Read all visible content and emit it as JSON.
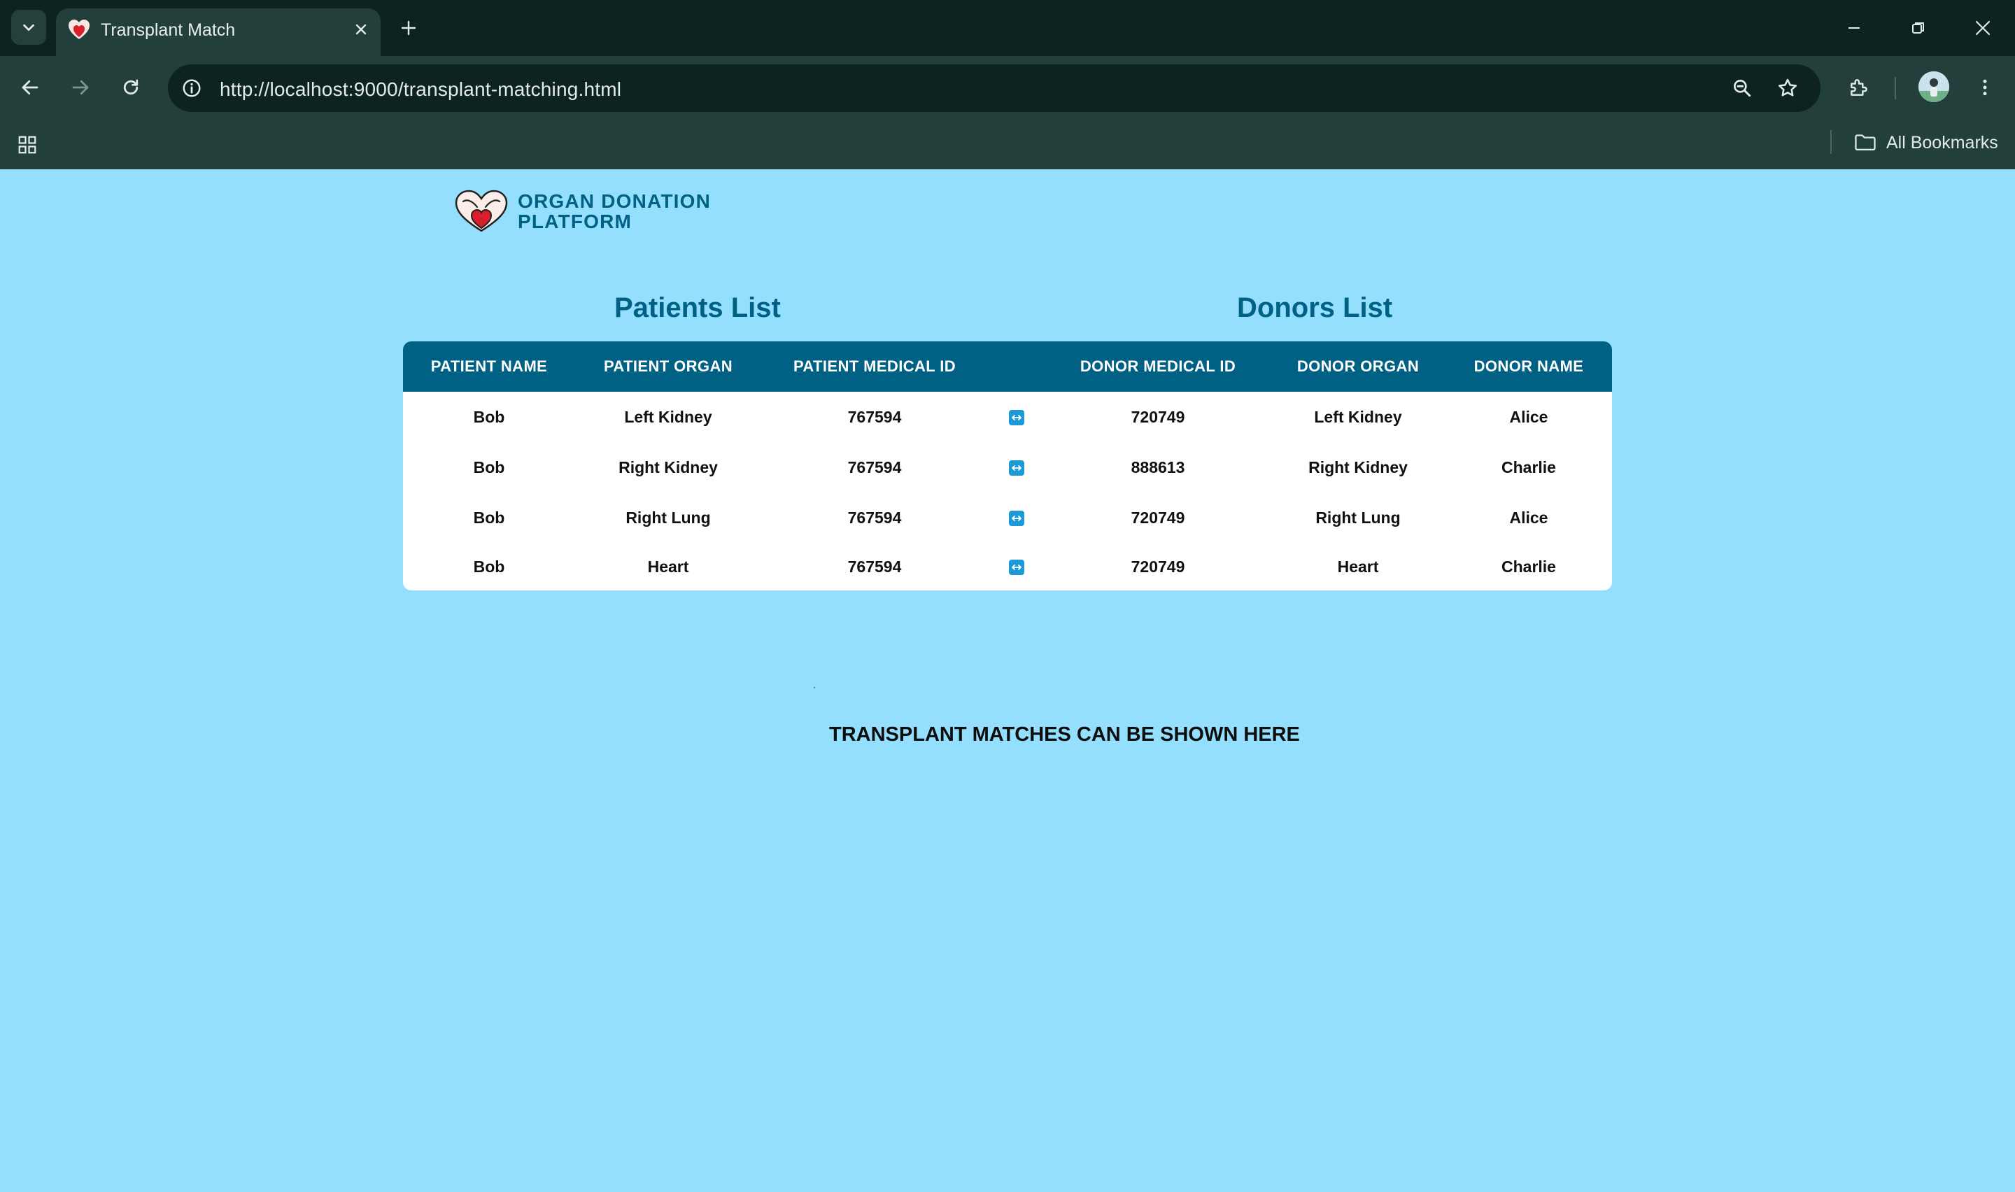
{
  "browser": {
    "tab_title": "Transplant Match",
    "url": "http://localhost:9000/transplant-matching.html",
    "bookmarks_label": "All Bookmarks"
  },
  "logo": {
    "line1": "ORGAN DONATION",
    "line2": "PLATFORM"
  },
  "sections": {
    "patients_title": "Patients List",
    "donors_title": "Donors List"
  },
  "table": {
    "headers": {
      "patient_name": "PATIENT NAME",
      "patient_organ": "PATIENT ORGAN",
      "patient_medical_id": "PATIENT MEDICAL ID",
      "link": "",
      "donor_medical_id": "DONOR MEDICAL ID",
      "donor_organ": "DONOR ORGAN",
      "donor_name": "DONOR NAME"
    },
    "rows": [
      {
        "patient_name": "Bob",
        "patient_organ": "Left Kidney",
        "patient_medical_id": "767594",
        "link_icon": "swap-arrows-icon",
        "donor_medical_id": "720749",
        "donor_organ": "Left Kidney",
        "donor_name": "Alice"
      },
      {
        "patient_name": "Bob",
        "patient_organ": "Right Kidney",
        "patient_medical_id": "767594",
        "link_icon": "swap-arrows-icon",
        "donor_medical_id": "888613",
        "donor_organ": "Right Kidney",
        "donor_name": "Charlie"
      },
      {
        "patient_name": "Bob",
        "patient_organ": "Right Lung",
        "patient_medical_id": "767594",
        "link_icon": "swap-arrows-icon",
        "donor_medical_id": "720749",
        "donor_organ": "Right Lung",
        "donor_name": "Alice"
      },
      {
        "patient_name": "Bob",
        "patient_organ": "Heart",
        "patient_medical_id": "767594",
        "link_icon": "swap-arrows-icon",
        "donor_medical_id": "720749",
        "donor_organ": "Heart",
        "donor_name": "Charlie"
      }
    ]
  },
  "placeholder_text": "TRANSPLANT MATCHES CAN BE SHOWN HERE",
  "colors": {
    "page_background": "#94dffd",
    "brand_primary": "#006185",
    "table_background": "#ffffff",
    "link_icon": "#1d9ad6",
    "chrome_dark": "#0c2320",
    "chrome_toolbar": "#233f3c"
  }
}
